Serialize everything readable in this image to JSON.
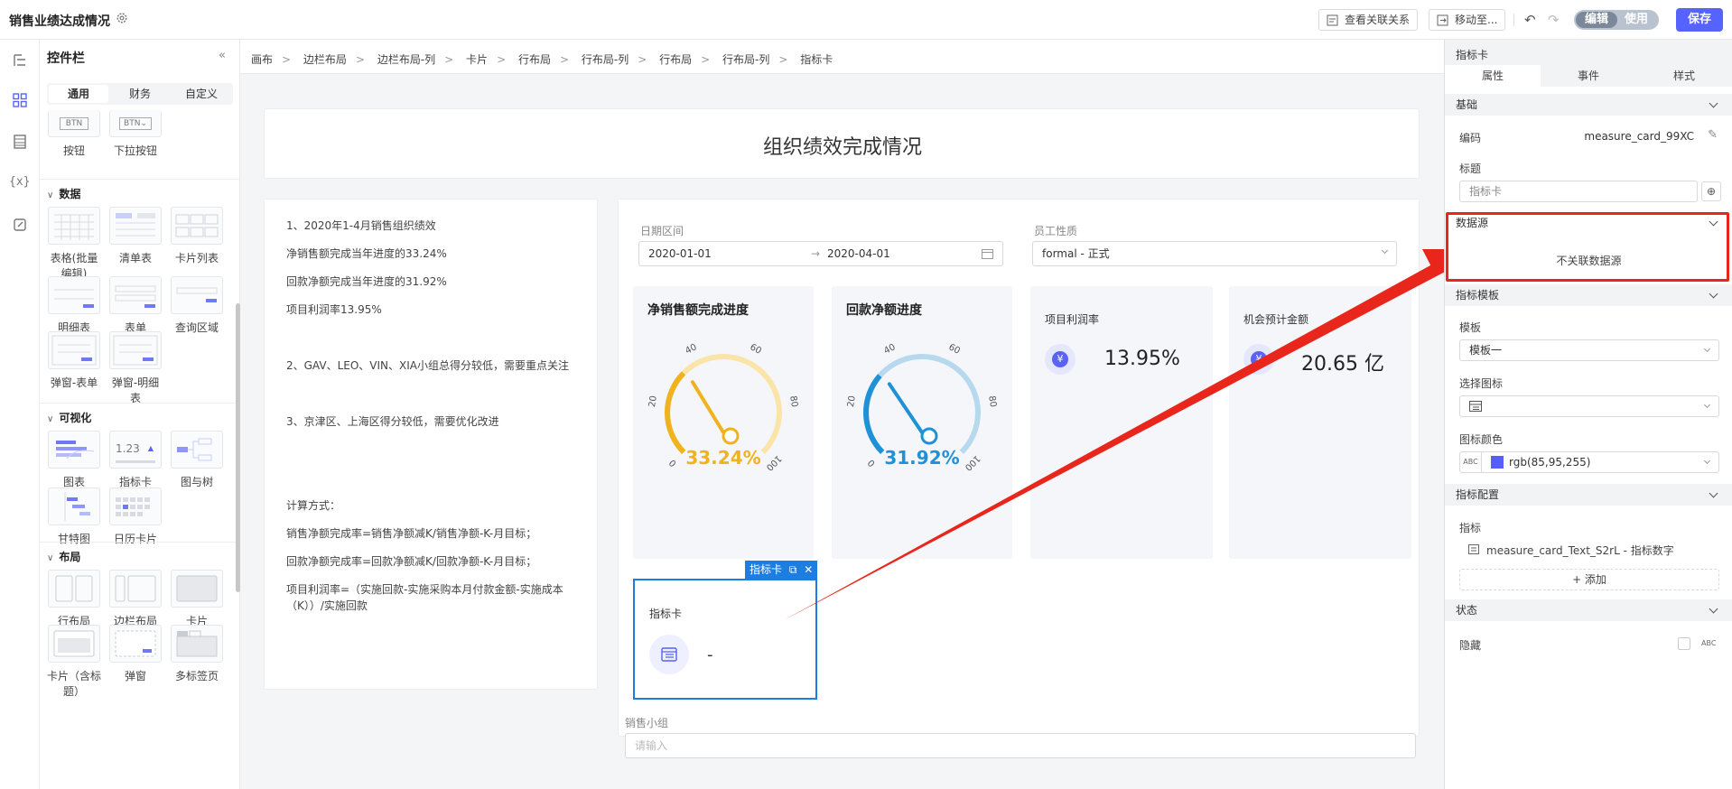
{
  "app": {
    "title": "销售业绩达成情况"
  },
  "toolbar": {
    "relation": "查看关联关系",
    "move": "移动至...",
    "mode_edit": "编辑",
    "mode_use": "使用",
    "save": "保存"
  },
  "panel": {
    "title": "控件栏",
    "tabs": [
      "通用",
      "财务",
      "自定义"
    ],
    "top_widgets": [
      "按钮",
      "下拉按钮"
    ],
    "btn_thumb": [
      "BTN",
      "BTN"
    ],
    "sections": {
      "data": "数据",
      "visual": "可视化",
      "layout": "布局"
    },
    "data_widgets": [
      "表格(批量",
      "编辑)",
      "清单表",
      "卡片列表",
      "明细表",
      "表单",
      "查询区域",
      "弹窗-表单",
      "弹窗-明细",
      "表"
    ],
    "visual_widgets": [
      "图表",
      "指标卡",
      "图与树",
      "甘特图",
      "日历卡片"
    ],
    "metric_thumb": "1.23",
    "layout_widgets": [
      "行布局",
      "边栏布局",
      "卡片",
      "卡片（含标",
      "题）",
      "弹窗",
      "多标签页"
    ]
  },
  "breadcrumb": [
    "画布",
    "边栏布局",
    "边栏布局-列",
    "卡片",
    "行布局",
    "行布局-列",
    "行布局",
    "行布局-列",
    "指标卡"
  ],
  "report": {
    "title": "组织绩效完成情况",
    "notes": [
      "1、2020年1-4月销售组织绩效",
      "净销售额完成当年进度的33.24%",
      "回款净额完成当年进度的31.92%",
      "项目利润率13.95%",
      "2、GAV、LEO、VIN、XIA小组总得分较低，需要重点关注",
      "3、京津区、上海区得分较低，需要优化改进",
      "计算方式：",
      "销售净额完成率=销售净额减K/销售净额-K-月目标；",
      "回款净额完成率=回款净额减K/回款净额-K-月目标；",
      "项目利润率=（实施回款-实施采购本月付款金额-实施成本",
      "（K））/实施回款"
    ],
    "filters": {
      "date_label": "日期区间",
      "date_from": "2020-01-01",
      "date_to": "2020-04-01",
      "emp_label": "员工性质",
      "emp_value": "formal - 正式"
    },
    "gauges": [
      {
        "title": "净销售额完成进度",
        "value_text": "33.24%",
        "value": 33.24,
        "color": "#f0b21e",
        "track": "#fae4a7"
      },
      {
        "title": "回款净额进度",
        "value_text": "31.92%",
        "value": 31.92,
        "color": "#1f91d6",
        "track": "#b7d9ee"
      }
    ],
    "gauge_ticks": [
      "0",
      "20",
      "40",
      "60",
      "80",
      "100"
    ],
    "kpis": [
      {
        "title": "项目利润率",
        "value": "13.95%",
        "icon": "¥"
      },
      {
        "title": "机会预计金额",
        "value": "20.65 亿",
        "icon": "¥"
      }
    ],
    "selected_card": {
      "tag": "指标卡",
      "title": "指标卡",
      "value": "-"
    },
    "bottom": {
      "label": "销售小组",
      "placeholder": "请输入"
    }
  },
  "props": {
    "header": "指标卡",
    "tabs": [
      "属性",
      "事件",
      "样式"
    ],
    "basic": "基础",
    "code_label": "编码",
    "code_value": "measure_card_99XC",
    "title_label": "标题",
    "title_value": "指标卡",
    "datasource": "数据源",
    "datasource_value": "不关联数据源",
    "template": "指标模板",
    "template_label": "模板",
    "template_value": "模板一",
    "icon_label": "选择图标",
    "color_label": "图标颜色",
    "color_value": "rgb(85,95,255)",
    "abc": "ABC",
    "config": "指标配置",
    "metric_label": "指标",
    "metric_value": "measure_card_Text_S2rL - 指标数字",
    "add": "+ 添加",
    "state": "状态",
    "hidden_label": "隐藏",
    "abc2": "ABC"
  },
  "colors": {
    "accent": "#5763ff",
    "highlight": "#e8261c",
    "selected": "#1c7ee0",
    "swatch": "#555fff"
  }
}
